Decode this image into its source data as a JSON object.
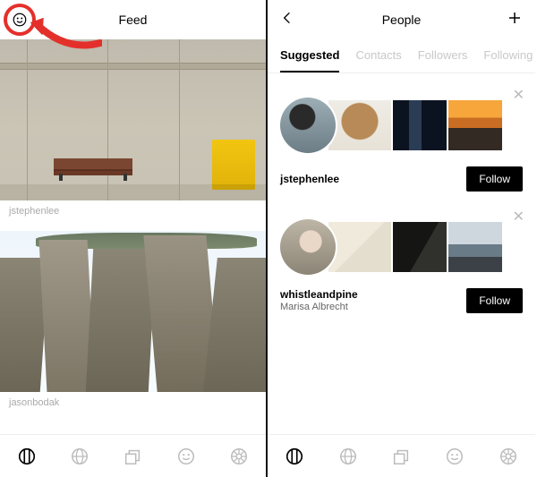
{
  "left": {
    "title": "Feed",
    "feed": [
      {
        "username": "jstephenlee"
      },
      {
        "username": "jasonbodak"
      }
    ]
  },
  "right": {
    "title": "People",
    "tabs": [
      "Suggested",
      "Contacts",
      "Followers",
      "Following"
    ],
    "activeTab": 0,
    "cards": [
      {
        "username": "jstephenlee",
        "realname": "",
        "follow": "Follow"
      },
      {
        "username": "whistleandpine",
        "realname": "Marisa Albrecht",
        "follow": "Follow"
      }
    ]
  },
  "nav_icons": [
    "feed-icon",
    "globe-icon",
    "layers-icon",
    "smile-icon",
    "wheel-icon"
  ]
}
